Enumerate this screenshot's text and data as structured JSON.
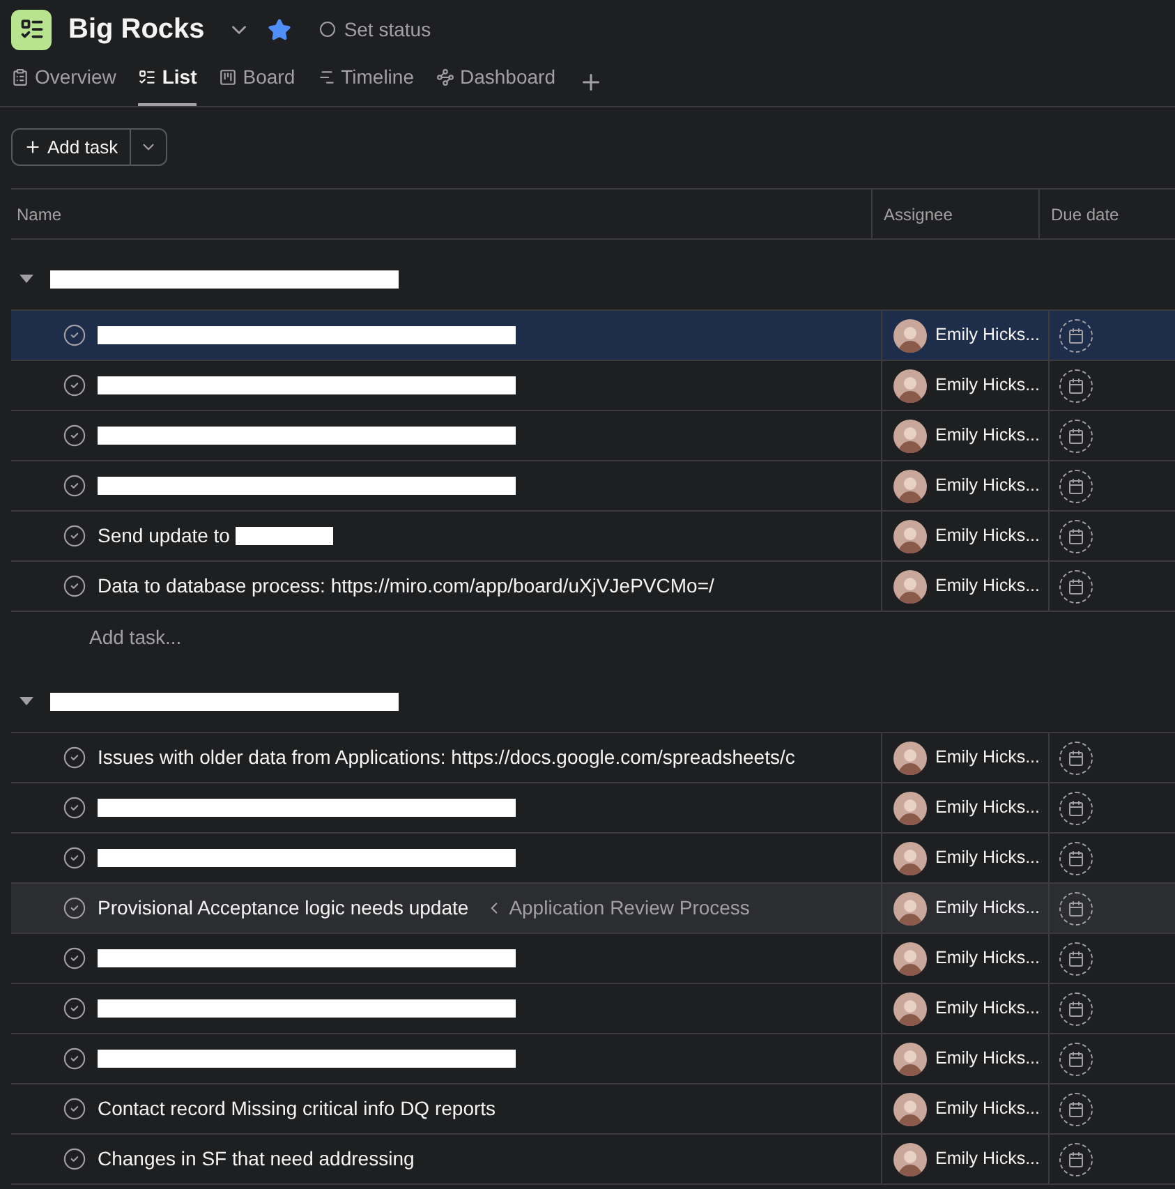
{
  "project": {
    "title": "Big Rocks",
    "starred": true,
    "status": "Set status"
  },
  "tabs": [
    {
      "label": "Overview",
      "selected": false
    },
    {
      "label": "List",
      "selected": true
    },
    {
      "label": "Board",
      "selected": false
    },
    {
      "label": "Timeline",
      "selected": false
    },
    {
      "label": "Dashboard",
      "selected": false
    }
  ],
  "add_task_button": "Add task",
  "table": {
    "columns": [
      "Name",
      "Assignee",
      "Due date"
    ],
    "sections": [
      {
        "redaction": true,
        "expanded": true,
        "add_task": "Add task...",
        "tasks": [
          {
            "redaction": true,
            "assignee": "Emily Hicks...",
            "selected": true,
            "hovered": false
          },
          {
            "redaction": true,
            "assignee": "Emily Hicks...",
            "selected": false,
            "hovered": false
          },
          {
            "redaction": true,
            "assignee": "Emily Hicks...",
            "selected": false,
            "hovered": false
          },
          {
            "redaction": true,
            "assignee": "Emily Hicks...",
            "selected": false,
            "hovered": false
          },
          {
            "title": "Send update to",
            "redaction": true,
            "assignee": "Emily Hicks...",
            "selected": false,
            "hovered": false
          },
          {
            "title": "Data to database process: https://miro.com/app/board/uXjVJePVCMo=/",
            "assignee": "Emily Hicks...",
            "selected": false,
            "hovered": false
          }
        ]
      },
      {
        "redaction": true,
        "expanded": true,
        "tasks": [
          {
            "title": "Issues with older data from Applications: https://docs.google.com/spreadsheets/c",
            "assignee": "Emily Hicks...",
            "selected": false,
            "hovered": false
          },
          {
            "redaction": true,
            "assignee": "Emily Hicks...",
            "selected": false,
            "hovered": false
          },
          {
            "redaction": true,
            "assignee": "Emily Hicks...",
            "selected": false,
            "hovered": false
          },
          {
            "title": "Provisional Acceptance logic needs update",
            "parent": "Application Review Process",
            "assignee": "Emily Hicks...",
            "selected": false,
            "hovered": true
          },
          {
            "redaction": true,
            "assignee": "Emily Hicks...",
            "selected": false,
            "hovered": false
          },
          {
            "redaction": true,
            "assignee": "Emily Hicks...",
            "selected": false,
            "hovered": false
          },
          {
            "redaction": true,
            "assignee": "Emily Hicks...",
            "selected": false,
            "hovered": false
          },
          {
            "title": "Contact record Missing critical info DQ reports",
            "assignee": "Emily Hicks...",
            "selected": false,
            "hovered": false
          },
          {
            "title": "Changes in SF that need addressing",
            "assignee": "Emily Hicks...",
            "selected": false,
            "hovered": false
          }
        ]
      }
    ]
  }
}
